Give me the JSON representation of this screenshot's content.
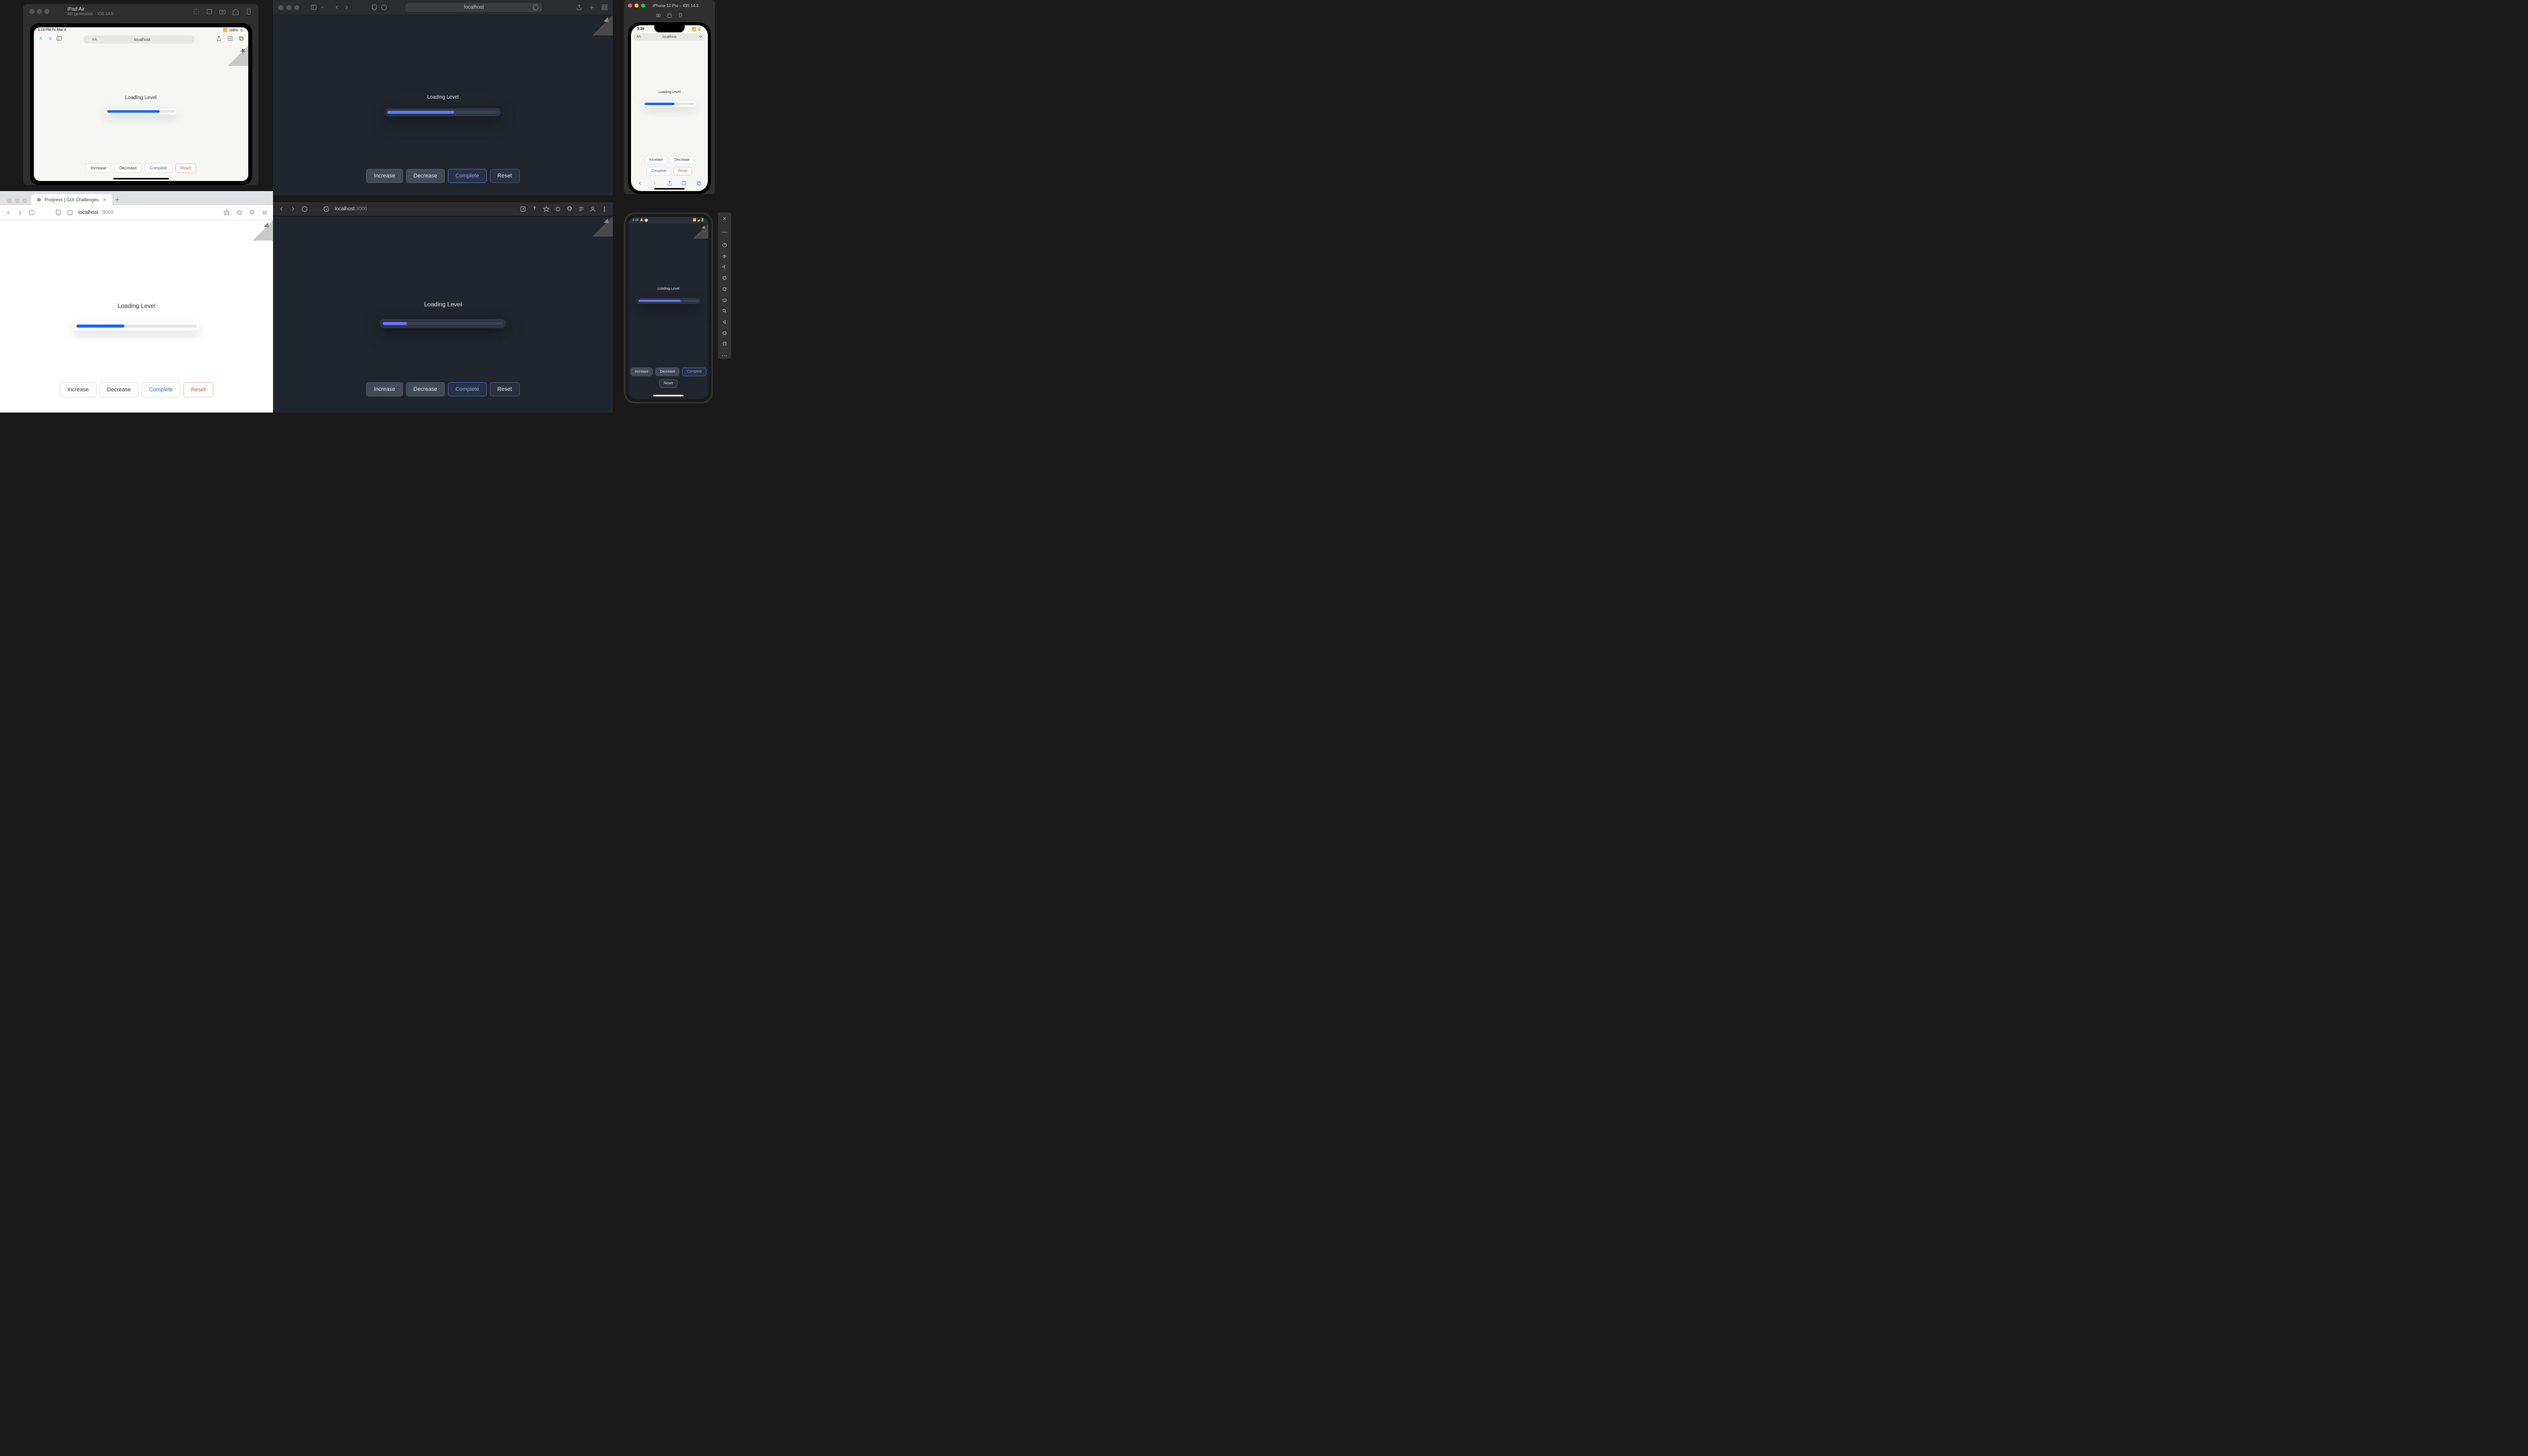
{
  "demo": {
    "heading": "Loading Level",
    "buttons": {
      "increase": "Increase",
      "decrease": "Decrease",
      "complete": "Complete",
      "reset": "Reset"
    }
  },
  "ipad_sim": {
    "device_name": "iPad Air",
    "device_detail": "4th generation – iOS 14.5",
    "status_left": "3:19 PM   Fri Mar 4",
    "status_right": "100%",
    "addr": "localhost",
    "progress_percent": 78
  },
  "safari_desktop": {
    "addr": "localhost",
    "progress_percent": 60
  },
  "chrome_light": {
    "tab_title": "Progress | GUI Challenges",
    "host": "localhost",
    "port": ":3000",
    "progress_percent": 40
  },
  "chrome_dark": {
    "host": "localhost",
    "port": ":3000",
    "progress_percent": 20
  },
  "iphone_sim": {
    "device_name": "iPhone 12 Pro – iOS 14.5",
    "status_time": "3:19",
    "addr": "localhost",
    "progress_percent": 60
  },
  "android_emu": {
    "status_time": "3:19",
    "progress_percent": 70
  },
  "colors": {
    "progress_light": "#1864ff",
    "progress_dark": "#6177ff",
    "complete": "#3866e0",
    "reset": "#e05848"
  }
}
